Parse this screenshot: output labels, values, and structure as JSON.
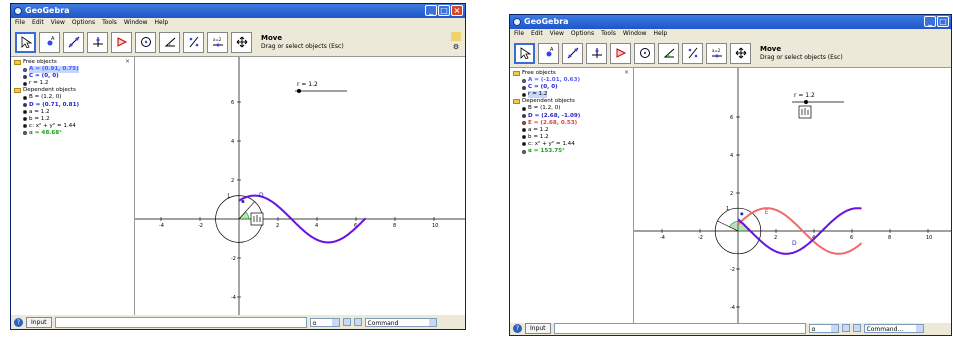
{
  "colors": {
    "titlebar": "#2160d0",
    "purple": "#6a11e0",
    "red": "#f26a6a",
    "green": "#1aa01a",
    "blue_obj": "#4b5bff"
  },
  "windows": [
    {
      "title": "GeoGebra",
      "menu": [
        "File",
        "Edit",
        "View",
        "Options",
        "Tools",
        "Window",
        "Help"
      ],
      "tools": [
        "move-tool",
        "point-tool",
        "line-tool",
        "perpendicular-tool",
        "polygon-tool",
        "circle-tool",
        "angle-tool",
        "reflect-tool",
        "slider-tool",
        "move-view-tool"
      ],
      "mode_title": "Move",
      "mode_hint": "Drag or select objects (Esc)",
      "algebra": {
        "free_header": "Free objects",
        "free": [
          {
            "text": "A = (0.91, 0.75)",
            "color": "#4b5bff",
            "highlight": true
          },
          {
            "text": "C = (0, 0)",
            "color": "#2222cc"
          },
          {
            "text": "r = 1.2",
            "color": "#000000"
          }
        ],
        "dep_header": "Dependent objects",
        "dep": [
          {
            "text": "B = (1.2, 0)",
            "color": "#000000"
          },
          {
            "text": "D = (0.71, 0.81)",
            "color": "#2222cc"
          },
          {
            "text": "a = 1.2",
            "color": "#000000"
          },
          {
            "text": "b = 1.2",
            "color": "#000000"
          },
          {
            "text": "c: x² + y² = 1.44",
            "color": "#000000"
          },
          {
            "text": "α = 48.68°",
            "color": "#1aa01a"
          }
        ]
      },
      "slider_label": "r = 1.2",
      "x_ticks": [
        "-4",
        "-2",
        "2",
        "4",
        "6",
        "8",
        "10"
      ],
      "y_ticks": [
        "6",
        "4",
        "2",
        "-2",
        "-4"
      ],
      "point_label": "D",
      "axis_one": "1",
      "input_label": "Input",
      "alpha_symbol": "α",
      "command_label": "Command"
    },
    {
      "title": "GeoGebra",
      "menu": [
        "File",
        "Edit",
        "View",
        "Options",
        "Tools",
        "Window",
        "Help"
      ],
      "tools": [
        "move-tool",
        "point-tool",
        "line-tool",
        "perpendicular-tool",
        "polygon-tool",
        "circle-tool",
        "angle-tool",
        "reflect-tool",
        "slider-tool",
        "move-view-tool"
      ],
      "mode_title": "Move",
      "mode_hint": "Drag or select objects (Esc)",
      "algebra": {
        "free_header": "Free objects",
        "free": [
          {
            "text": "A = (-1.01, 0.63)",
            "color": "#4b5bff"
          },
          {
            "text": "C = (0, 0)",
            "color": "#2222cc"
          },
          {
            "text": "r = 1.2",
            "color": "#000000",
            "highlight": true
          }
        ],
        "dep_header": "Dependent objects",
        "dep": [
          {
            "text": "B = (1.2, 0)",
            "color": "#000000"
          },
          {
            "text": "D = (2.68, -1.09)",
            "color": "#2222cc"
          },
          {
            "text": "E = (2.68, 0.53)",
            "color": "#e23b3b"
          },
          {
            "text": "a = 1.2",
            "color": "#000000"
          },
          {
            "text": "b = 1.2",
            "color": "#000000"
          },
          {
            "text": "c: x² + y² = 1.44",
            "color": "#000000"
          },
          {
            "text": "α = 153.75°",
            "color": "#1aa01a"
          }
        ]
      },
      "slider_label": "r = 1.2",
      "x_ticks": [
        "-4",
        "-2",
        "2",
        "4",
        "6",
        "8",
        "10"
      ],
      "y_ticks": [
        "6",
        "4",
        "2",
        "-2",
        "-4"
      ],
      "point_label": "D",
      "point_label_2": "E",
      "axis_one": "1",
      "input_label": "Input",
      "alpha_symbol": "α",
      "command_label": "Command..."
    }
  ]
}
